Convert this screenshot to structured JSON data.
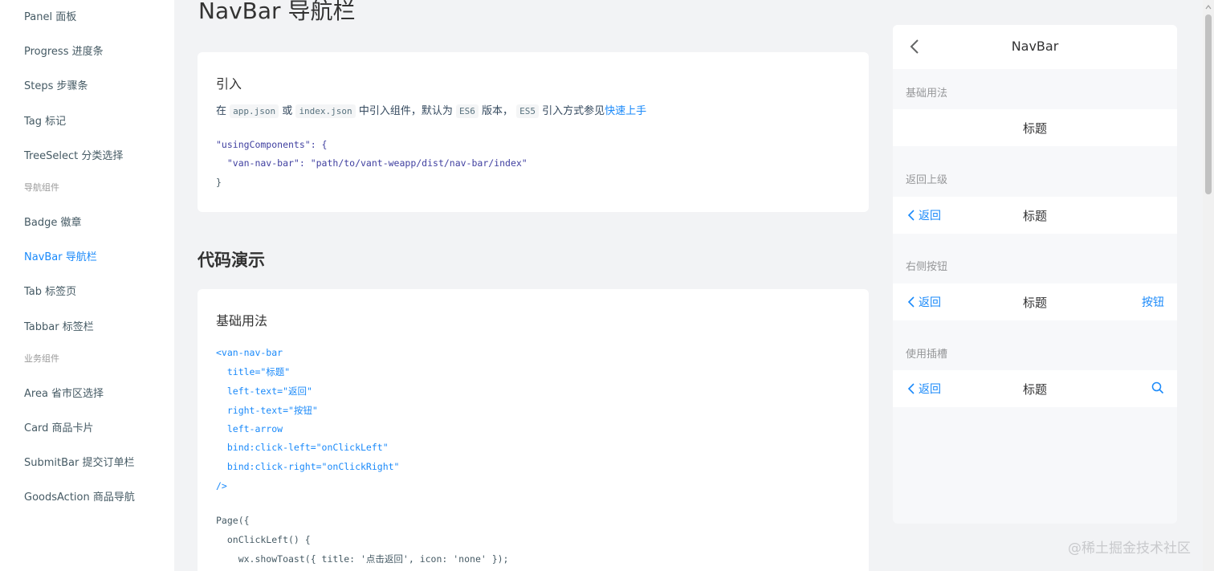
{
  "sidebar": {
    "items": [
      {
        "label": "Panel 面板"
      },
      {
        "label": "Progress 进度条"
      },
      {
        "label": "Steps 步骤条"
      },
      {
        "label": "Tag 标记"
      },
      {
        "label": "TreeSelect 分类选择"
      },
      {
        "group": "导航组件"
      },
      {
        "label": "Badge 徽章"
      },
      {
        "label": "NavBar 导航栏",
        "active": true
      },
      {
        "label": "Tab 标签页"
      },
      {
        "label": "Tabbar 标签栏"
      },
      {
        "group": "业务组件"
      },
      {
        "label": "Area 省市区选择"
      },
      {
        "label": "Card 商品卡片"
      },
      {
        "label": "SubmitBar 提交订单栏"
      },
      {
        "label": "GoodsAction 商品导航"
      }
    ]
  },
  "main": {
    "page_title": "NavBar 导航栏",
    "intro": {
      "title": "引入",
      "text_1": "在",
      "code_1": "app.json",
      "text_2": "或",
      "code_2": "index.json",
      "text_3": "中引入组件，默认为",
      "code_3": "ES6",
      "text_4": "版本，",
      "code_4": "ES5",
      "text_5": "引入方式参见",
      "link": "快速上手",
      "code_lines": [
        "\"usingComponents\": {",
        "  \"van-nav-bar\": \"path/to/vant-weapp/dist/nav-bar/index\"",
        "}"
      ]
    },
    "demo_section_title": "代码演示",
    "basic": {
      "title": "基础用法",
      "code_lines": [
        "<van-nav-bar",
        "  title=\"标题\"",
        "  left-text=\"返回\"",
        "  right-text=\"按钮\"",
        "  left-arrow",
        "  bind:click-left=\"onClickLeft\"",
        "  bind:click-right=\"onClickRight\"",
        "/>",
        "",
        "Page({",
        "  onClickLeft() {",
        "    wx.showToast({ title: '点击返回', icon: 'none' });"
      ]
    }
  },
  "simulator": {
    "header_title": "NavBar",
    "demos": [
      {
        "title": "基础用法",
        "nav_title": "标题",
        "left_text": "",
        "right_text": "",
        "right_icon": ""
      },
      {
        "title": "返回上级",
        "nav_title": "标题",
        "left_text": "返回",
        "right_text": "",
        "right_icon": ""
      },
      {
        "title": "右侧按钮",
        "nav_title": "标题",
        "left_text": "返回",
        "right_text": "按钮",
        "right_icon": ""
      },
      {
        "title": "使用插槽",
        "nav_title": "标题",
        "left_text": "返回",
        "right_text": "",
        "right_icon": "search-icon"
      }
    ]
  },
  "watermark": "@稀土掘金技术社区",
  "colors": {
    "accent": "#1989fa",
    "background": "#f2f3f5",
    "card": "#ffffff",
    "muted_text": "#969799"
  }
}
